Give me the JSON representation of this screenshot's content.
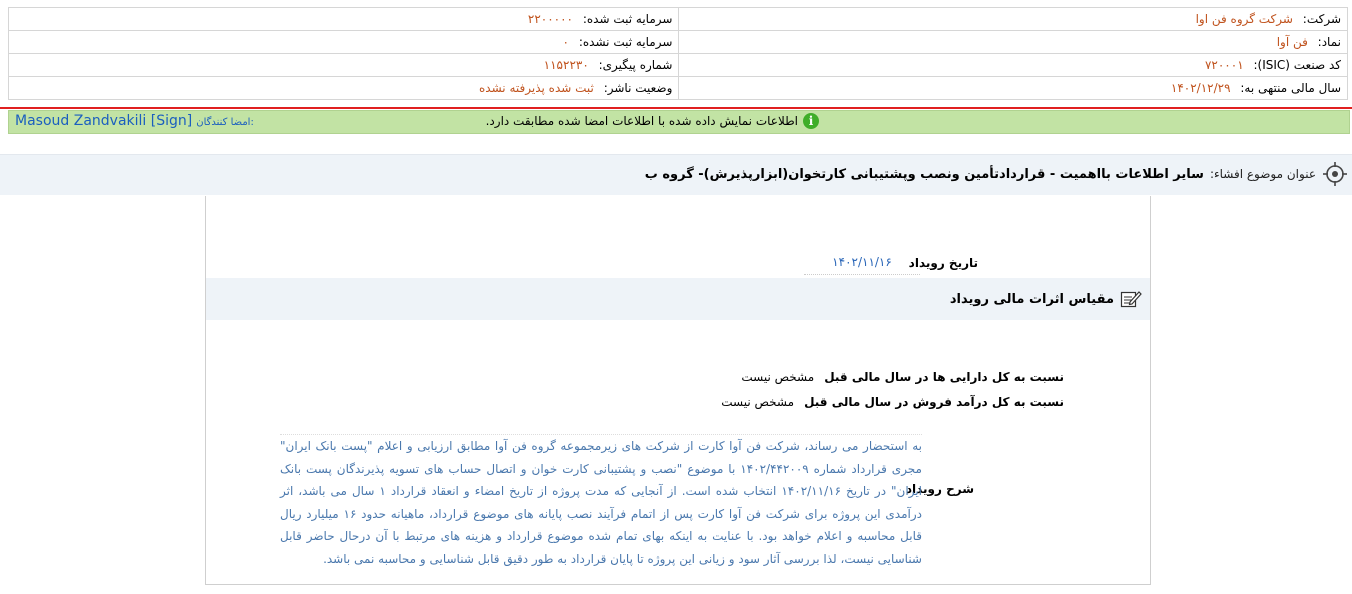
{
  "header": {
    "company_label": "شرکت:",
    "company_value": "شرکت گروه فن اوا",
    "reg_capital_label": "سرمایه ثبت شده:",
    "reg_capital_value": "۲۲۰۰۰۰۰",
    "symbol_label": "نماد:",
    "symbol_value": "فن آوا",
    "unreg_capital_label": "سرمایه ثبت نشده:",
    "unreg_capital_value": "۰",
    "isic_label": "کد صنعت (ISIC):",
    "isic_value": "۷۲۰۰۰۱",
    "tracking_label": "شماره پیگیری:",
    "tracking_value": "۱۱۵۲۲۳۰",
    "fiscal_label": "سال مالی منتهی به:",
    "fiscal_value": "۱۴۰۲/۱۲/۲۹",
    "publisher_status_label": "وضعیت ناشر:",
    "publisher_status_value": "ثبت شده پذیرفته نشده"
  },
  "verify": {
    "message": "اطلاعات نمایش داده شده با اطلاعات امضا شده مطابقت دارد.",
    "signers_label": "امضا کنندگان:",
    "signer_name": "Masoud Zandvakili [Sign]",
    "icon": "info-icon",
    "color": "#c2e3a4"
  },
  "title": {
    "label": "عنوان موضوع افشاء:",
    "text": "سایر اطلاعات بااهمیت - قراردادتأمین ونصب وپشتیبانی کارتخوان(ابزارپذیرش)- گروه ب"
  },
  "event": {
    "date_label": "تاریخ رویداد",
    "date_value": "۱۴۰۲/۱۱/۱۶",
    "section_title": "مقیاس اثرات مالی رویداد",
    "assets_label": "نسبت به کل دارایی ها در سال مالی قبل",
    "assets_value": "مشخص نیست",
    "revenue_label": "نسبت به کل درآمد فروش در سال مالی قبل",
    "revenue_value": "مشخص نیست",
    "desc_label": "شرح رویداد",
    "desc_text": "به استحضار می رساند، شرکت فن آوا کارت از شرکت های زیرمجموعه گروه فن آوا مطابق ارزیابی و اعلام \"پست بانک ایران\" مجری قرارداد شماره ۱۴۰۲/۴۴۲۰۰۹ با موضوع \"نصب و پشتیبانی کارت خوان و اتصال حساب های تسویه پذیرندگان پست بانک ایران\" در تاریخ ۱۴۰۲/۱۱/۱۶ انتخاب شده است. از آنجایی که مدت پروژه از تاریخ امضاء و انعقاد قرارداد ۱ سال می باشد، اثر درآمدی این پروژه برای شرکت فن آوا کارت پس از اتمام فرآیند نصب پایانه های موضوع قرارداد، ماهیانه حدود ۱۶ میلیارد ریال قابل محاسبه و اعلام خواهد بود. با عنایت به اینکه بهای تمام شده موضوع قرارداد و هزینه های مرتبط با آن درحال حاضر قابل شناسایی نیست، لذا بررسی آثار سود و زیانی این پروژه تا پایان قرارداد به طور دقیق قابل شناسایی و محاسبه نمی باشد."
  }
}
